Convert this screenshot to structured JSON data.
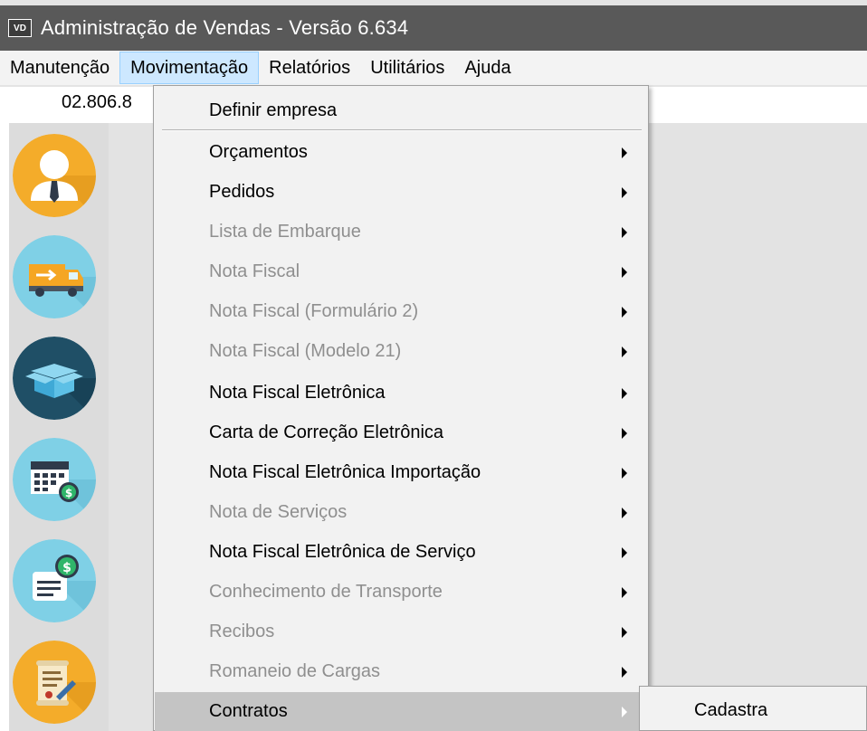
{
  "window": {
    "icon_text": "VD",
    "title": "Administração de Vendas - Versão 6.634"
  },
  "menubar": {
    "items": [
      {
        "label": "Manutenção"
      },
      {
        "label": "Movimentação"
      },
      {
        "label": "Relatórios"
      },
      {
        "label": "Utilitários"
      },
      {
        "label": "Ajuda"
      }
    ]
  },
  "info": {
    "company_code": "02.806.8"
  },
  "toolbar": {
    "icons": [
      "user-icon",
      "truck-icon",
      "box-icon",
      "calendar-money-icon",
      "invoice-money-icon",
      "contract-icon"
    ]
  },
  "dropdown": {
    "items": [
      {
        "label": "Definir empresa",
        "enabled": true,
        "submenu": false
      },
      {
        "label": "Orçamentos",
        "enabled": true,
        "submenu": true
      },
      {
        "label": "Pedidos",
        "enabled": true,
        "submenu": true
      },
      {
        "label": "Lista de Embarque",
        "enabled": false,
        "submenu": true
      },
      {
        "label": "Nota Fiscal",
        "enabled": false,
        "submenu": true
      },
      {
        "label": "Nota Fiscal (Formulário 2)",
        "enabled": false,
        "submenu": true
      },
      {
        "label": "Nota Fiscal (Modelo 21)",
        "enabled": false,
        "submenu": true
      },
      {
        "label": "Nota Fiscal Eletrônica",
        "enabled": true,
        "submenu": true
      },
      {
        "label": "Carta de Correção Eletrônica",
        "enabled": true,
        "submenu": true
      },
      {
        "label": "Nota Fiscal Eletrônica Importação",
        "enabled": true,
        "submenu": true
      },
      {
        "label": "Nota de Serviços",
        "enabled": false,
        "submenu": true
      },
      {
        "label": "Nota Fiscal Eletrônica de Serviço",
        "enabled": true,
        "submenu": true
      },
      {
        "label": "Conhecimento de Transporte",
        "enabled": false,
        "submenu": true
      },
      {
        "label": "Recibos",
        "enabled": false,
        "submenu": true
      },
      {
        "label": "Romaneio de Cargas",
        "enabled": false,
        "submenu": true
      },
      {
        "label": "Contratos",
        "enabled": true,
        "submenu": true,
        "highlighted": true
      }
    ]
  },
  "submenu": {
    "items": [
      {
        "label": "Cadastra"
      }
    ]
  }
}
